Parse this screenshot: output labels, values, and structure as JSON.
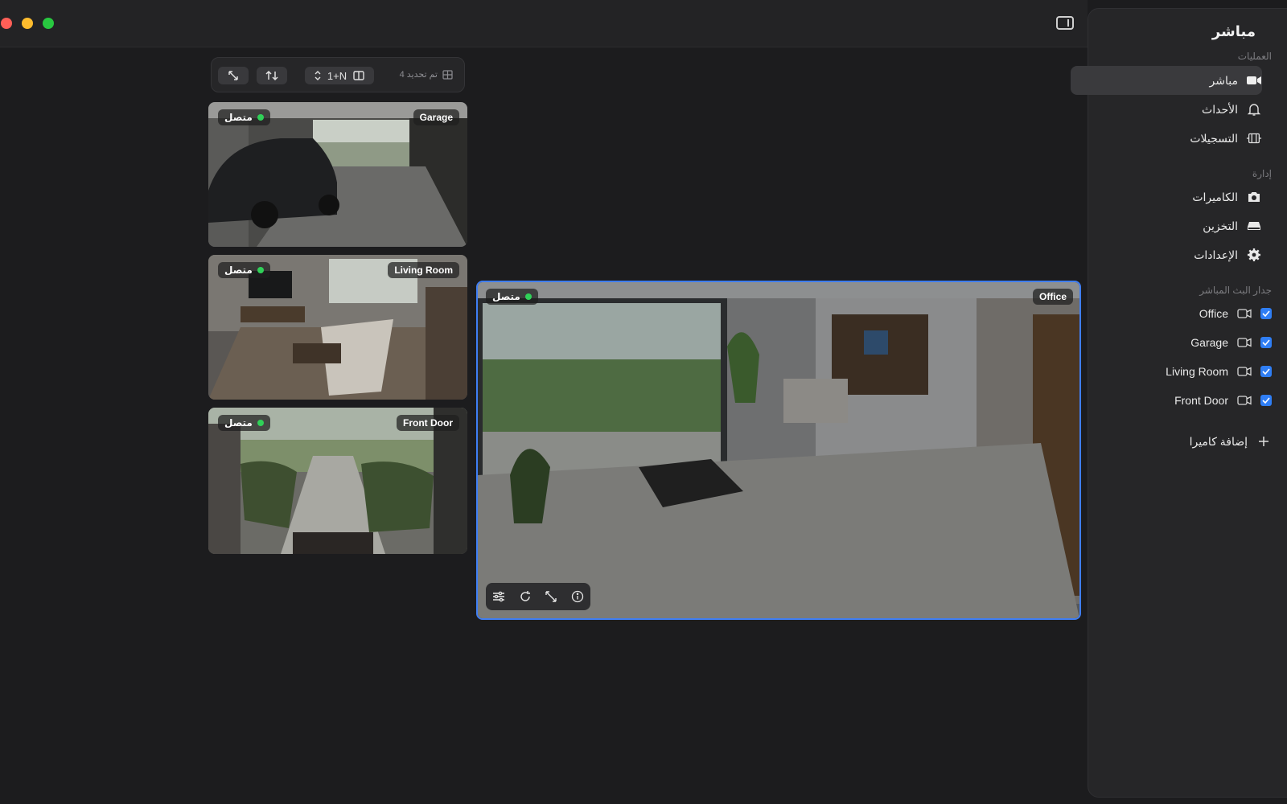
{
  "sidebar": {
    "title": "مباشر",
    "sections": {
      "operations": "العمليات",
      "management": "إدارة",
      "live_wall": "جدار البث المباشر"
    },
    "items": [
      {
        "label": "مباشر",
        "icon": "video-camera-icon",
        "active": true
      },
      {
        "label": "الأحداث",
        "icon": "bell-icon"
      },
      {
        "label": "التسجيلات",
        "icon": "film-icon"
      },
      {
        "label": "الكاميرات",
        "icon": "camera-icon"
      },
      {
        "label": "التخزين",
        "icon": "storage-drive-icon"
      },
      {
        "label": "الإعدادات",
        "icon": "gear-icon"
      }
    ],
    "cameras": [
      {
        "name": "Office",
        "checked": true
      },
      {
        "name": "Garage",
        "checked": true
      },
      {
        "name": "Living Room",
        "checked": true
      },
      {
        "name": "Front Door",
        "checked": true
      }
    ],
    "add_camera": "إضافة كاميرا"
  },
  "toolbar": {
    "layout_label": "1+N",
    "status": "تم تحديد 4"
  },
  "tiles": [
    {
      "name": "Garage",
      "status": "متصل"
    },
    {
      "name": "Living Room",
      "status": "متصل"
    },
    {
      "name": "Front Door",
      "status": "متصل"
    },
    {
      "name": "Office",
      "status": "متصل"
    }
  ],
  "colors": {
    "accent": "#3f7ef4",
    "online": "#30d158"
  }
}
